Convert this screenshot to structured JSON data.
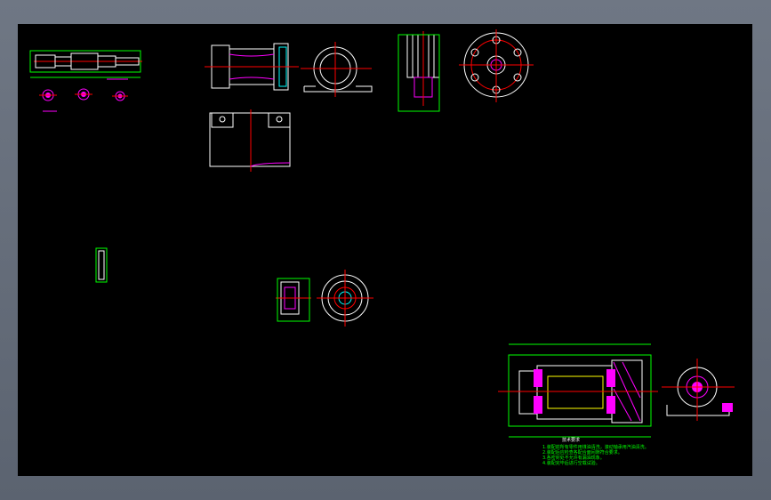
{
  "window": {
    "canvas_background": "#000000",
    "frame_color": "#646c78"
  },
  "colors": {
    "outline": "#ffffff",
    "dimension": "#00ff00",
    "centerline": "#ff0000",
    "section": "#ff00ff",
    "hidden": "#ffff00"
  },
  "drawing": {
    "technical_requirements_title": "技术要求",
    "notes": [
      "1.装配前所有零件用煤油清洗，滚动轴承用汽油清洗。",
      "2.装配后应检查各配合面间隙符合要求。",
      "3.各密封处不允许有漏油现象。",
      "4.装配完毕后进行空载试验。"
    ]
  }
}
